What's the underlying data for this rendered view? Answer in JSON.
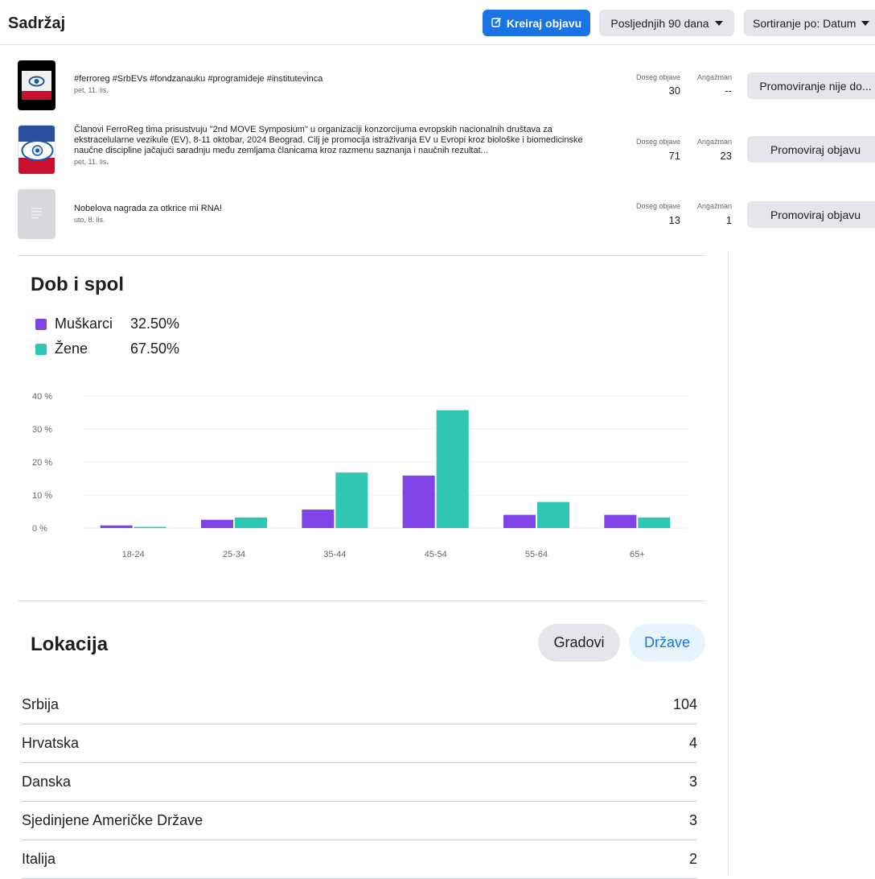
{
  "header": {
    "title": "Sadržaj",
    "create_label": "Kreiraj objavu",
    "range_label": "Posljednjih 90 dana",
    "sort_label": "Sortiranje po: Datum"
  },
  "posts": [
    {
      "text": "#ferroreg #SrbEVs #fondzanauku #programideje #institutevinca",
      "date": "pet, 11. lis.",
      "reach_label": "Doseg objave",
      "reach": "30",
      "eng_label": "Angažman",
      "eng": "--",
      "button": "Promoviranje nije do..."
    },
    {
      "text": "Članovi FerroReg tima prisustvuju \"2nd MOVE Symposium\" u organizaciji konzorcijuma evropskih nacionalnih društava za ekstracelularne vezikule (EV), 8-11 oktobar, 2024 Beograd. Cilj je promocija istraživanja EV u Evropi kroz biološke i biomedicinske naučne discipline jačajući saradnju među zemljama članicama kroz razmenu saznanja i naučnih rezultat...",
      "date": "pet, 11. lis.",
      "reach_label": "Doseg objave",
      "reach": "71",
      "eng_label": "Angažman",
      "eng": "23",
      "button": "Promoviraj objavu"
    },
    {
      "text": "Nobelova nagrada za otkrice mi RNA!",
      "date": "uto, 8. lis.",
      "reach_label": "Doseg objave",
      "reach": "13",
      "eng_label": "Angažman",
      "eng": "1",
      "button": "Promoviraj objavu"
    }
  ],
  "demographics": {
    "title": "Dob i spol",
    "legend": [
      {
        "name": "Muškarci",
        "value": "32.50%"
      },
      {
        "name": "Žene",
        "value": "67.50%"
      }
    ]
  },
  "chart_data": {
    "type": "bar",
    "categories": [
      "18-24",
      "25-34",
      "35-44",
      "45-54",
      "55-64",
      "65+"
    ],
    "series": [
      {
        "name": "Muškarci",
        "color": "#8043e6",
        "values": [
          0.8,
          2.5,
          5.6,
          15.9,
          4.0,
          4.0
        ]
      },
      {
        "name": "Žene",
        "color": "#2ec7b4",
        "values": [
          0.3,
          3.2,
          16.8,
          35.7,
          7.9,
          3.2
        ]
      }
    ],
    "yticks": [
      "0 %",
      "10 %",
      "20 %",
      "30 %",
      "40 %"
    ],
    "ylim": [
      0,
      40
    ],
    "grid": true
  },
  "location": {
    "title": "Lokacija",
    "tab_cities": "Gradovi",
    "tab_countries": "Države",
    "rows": [
      {
        "name": "Srbija",
        "count": "104"
      },
      {
        "name": "Hrvatska",
        "count": "4"
      },
      {
        "name": "Danska",
        "count": "3"
      },
      {
        "name": "Sjedinjene Američke Države",
        "count": "3"
      },
      {
        "name": "Italija",
        "count": "2"
      }
    ]
  }
}
